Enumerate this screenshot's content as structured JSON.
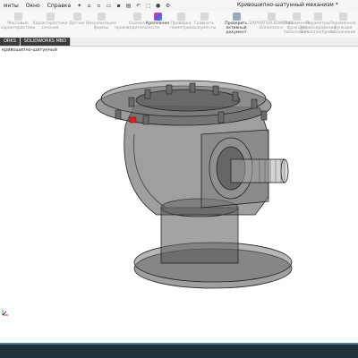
{
  "menu": {
    "items": [
      "мнты",
      "Окно",
      "Справка"
    ],
    "pin_icon": "pin-icon"
  },
  "window": {
    "title": "Кривошипно-шатунный механизм *"
  },
  "ribbon": {
    "buttons": [
      {
        "label": "Массовые характеристики"
      },
      {
        "label": "Характеристики сечения"
      },
      {
        "label": "Датчик"
      },
      {
        "label": "Визуализация формы"
      },
      {
        "label": "Оценка производительности"
      },
      {
        "label": "Крепления"
      },
      {
        "label": "Проверка геометрии"
      },
      {
        "label": "Сравнить документы"
      },
      {
        "label": "Проверить активный документ"
      },
      {
        "label": "DXPORTSOLIDWORKS Dimensions"
      },
      {
        "label": "Переменная функция Заполнения"
      },
      {
        "label": "Параметры Зафиксирования SimulationXpress"
      },
      {
        "label": "Переменная функция Заполнения"
      }
    ],
    "active_label": "Крепления",
    "check_label": "Проверить активный документ"
  },
  "tabs": [
    "ORKS",
    "SOLIDWORKS MBD"
  ],
  "tree": {
    "item": "кривошипно-шатунный"
  }
}
